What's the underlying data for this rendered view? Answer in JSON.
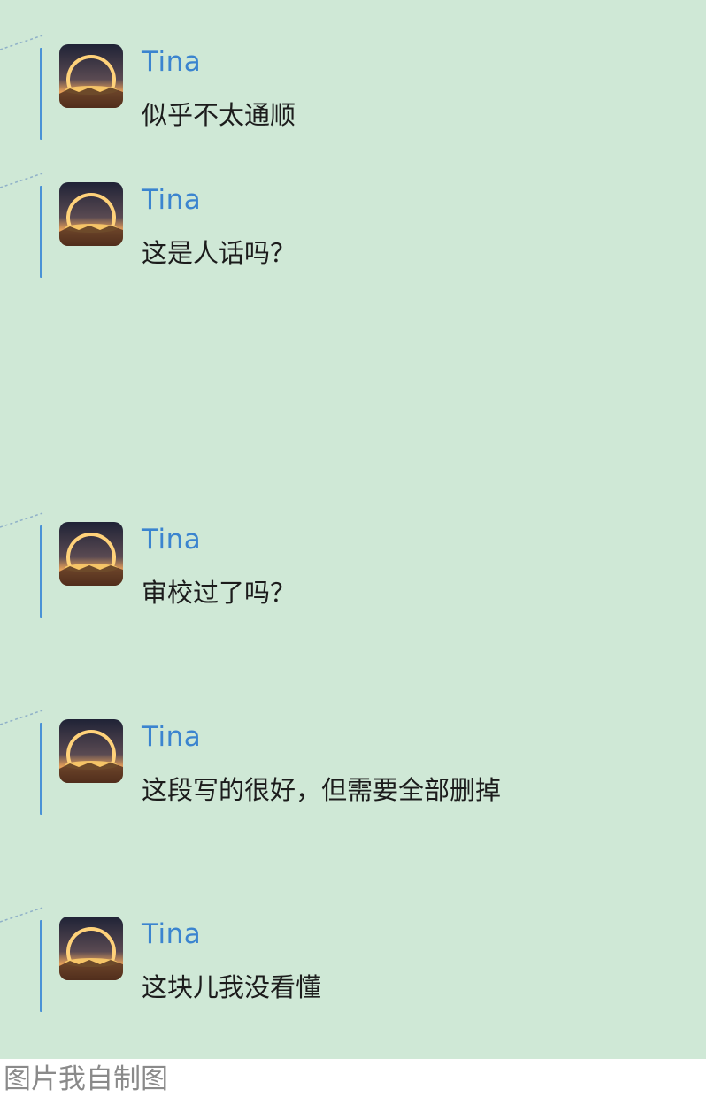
{
  "comments": [
    {
      "author": "Tina",
      "text": "似乎不太通顺",
      "avatar_icon": "sunset-ring-avatar"
    },
    {
      "author": "Tina",
      "text": "这是人话吗？",
      "avatar_icon": "sunset-ring-avatar"
    },
    {
      "author": "Tina",
      "text": "审校过了吗？",
      "avatar_icon": "sunset-ring-avatar"
    },
    {
      "author": "Tina",
      "text": "这段写的很好，但需要全部删掉",
      "avatar_icon": "sunset-ring-avatar"
    },
    {
      "author": "Tina",
      "text": "这块儿我没看懂",
      "avatar_icon": "sunset-ring-avatar"
    }
  ],
  "caption": "图片我自制图",
  "colors": {
    "panel_background": "#cfe8d6",
    "author_name": "#3b84cf",
    "comment_bar": "#4a92d6",
    "comment_text": "#1c1c1c",
    "caption_text": "#8a8a8a"
  }
}
